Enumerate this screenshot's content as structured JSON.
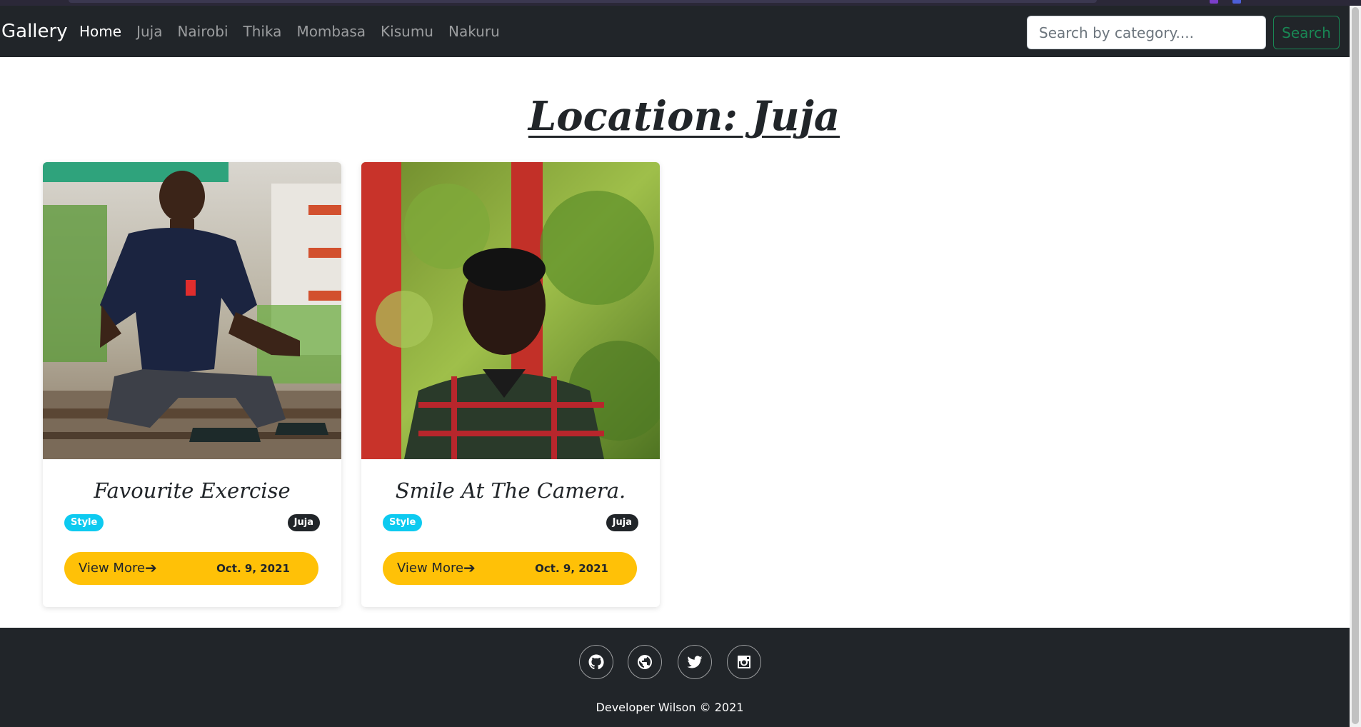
{
  "navbar": {
    "brand": "Gallery",
    "links": [
      {
        "label": "Home",
        "active": true
      },
      {
        "label": "Juja",
        "active": false
      },
      {
        "label": "Nairobi",
        "active": false
      },
      {
        "label": "Thika",
        "active": false
      },
      {
        "label": "Mombasa",
        "active": false
      },
      {
        "label": "Kisumu",
        "active": false
      },
      {
        "label": "Nakuru",
        "active": false
      }
    ],
    "search": {
      "placeholder": "Search by category....",
      "value": "",
      "button_label": "Search"
    }
  },
  "page": {
    "title": "Location: Juja"
  },
  "cards": [
    {
      "title": "Favourite Exercise",
      "category": "Style",
      "location": "Juja",
      "button_label": "View More",
      "button_icon": "arrow-right-icon",
      "date": "Oct. 9, 2021"
    },
    {
      "title": "Smile At The Camera.",
      "category": "Style",
      "location": "Juja",
      "button_label": "View More",
      "button_icon": "arrow-right-icon",
      "date": "Oct. 9, 2021"
    }
  ],
  "footer": {
    "social": [
      "github-icon",
      "globe-icon",
      "twitter-icon",
      "instagram-icon"
    ],
    "copyright": "Developer Wilson © 2021"
  },
  "colors": {
    "navbar_bg": "#212529",
    "search_accent": "#198754",
    "button_yellow": "#ffc107",
    "badge_cyan": "#0dcaf0",
    "badge_dark": "#212529"
  }
}
